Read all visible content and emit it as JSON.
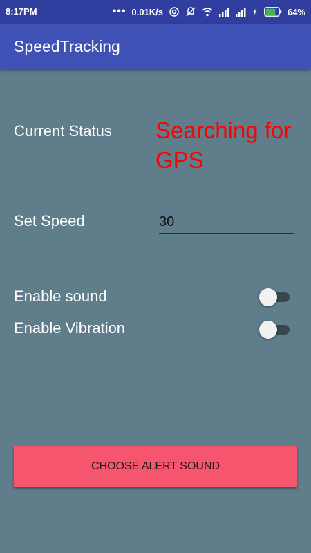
{
  "status_bar": {
    "time": "8:17PM",
    "dots": "•••",
    "net_speed": "0.01K/s",
    "battery": "64%",
    "icons": [
      "hotspot-icon",
      "mute-icon",
      "wifi-icon",
      "signal-icon",
      "signal-icon",
      "charging-icon",
      "battery-icon"
    ]
  },
  "app_bar": {
    "title": "SpeedTracking"
  },
  "current_status": {
    "label": "Current Status",
    "value": "Searching for GPS",
    "value_color": "#ff0000"
  },
  "set_speed": {
    "label": "Set Speed",
    "value": "30"
  },
  "enable_sound": {
    "label": "Enable sound",
    "checked": false
  },
  "enable_vibration": {
    "label": "Enable Vibration",
    "checked": false
  },
  "alert_button": {
    "label": "CHOOSE ALERT SOUND",
    "color": "#f5566d"
  },
  "colors": {
    "status_bar": "#303f9f",
    "app_bar": "#3f51b5",
    "background": "#607d8b"
  }
}
